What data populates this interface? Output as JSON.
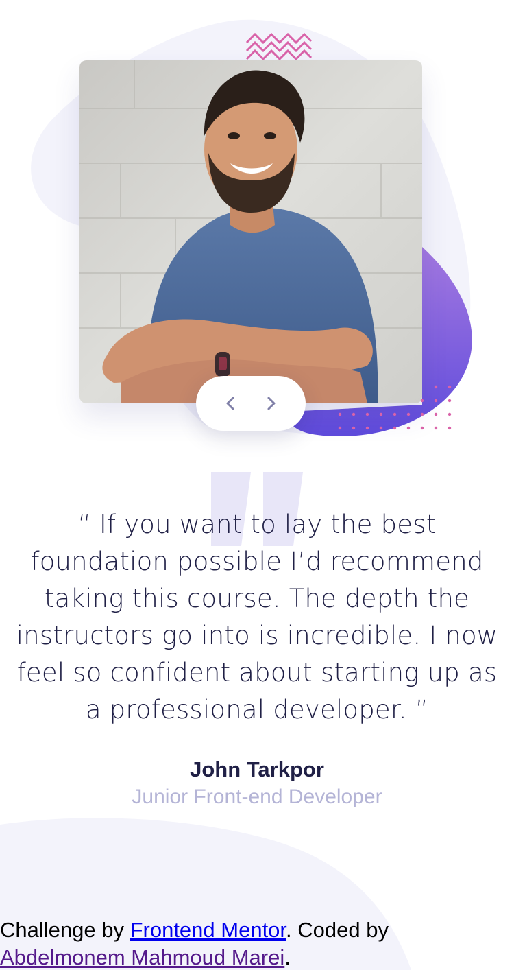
{
  "slider": {
    "prev_label": "Previous",
    "next_label": "Next",
    "photo_alt": "John Tarkpor"
  },
  "testimonial": {
    "quote": "“ If you want to lay the best foundation possible I’d recommend taking this course. The depth the instructors go into is incredible. I now feel so confident about starting up as a professional developer. ”",
    "name": "John Tarkpor",
    "role": "Junior Front-end Developer"
  },
  "attribution": {
    "prefix": "Challenge by ",
    "link1": "Frontend Mentor",
    "middle": ". Coded by ",
    "link2": "Abdelmonem Mahmoud Marei",
    "suffix": "."
  },
  "colors": {
    "dark_navy": "#202046",
    "grayish_blue": "#b4b4d6",
    "purple_accent": "#8a6bd6",
    "pink_pattern": "#d963a9",
    "light_bg": "#f3f3fb"
  },
  "icons": {
    "prev": "chevron-left-icon",
    "next": "chevron-right-icon",
    "quote": "quote-mark-icon"
  }
}
